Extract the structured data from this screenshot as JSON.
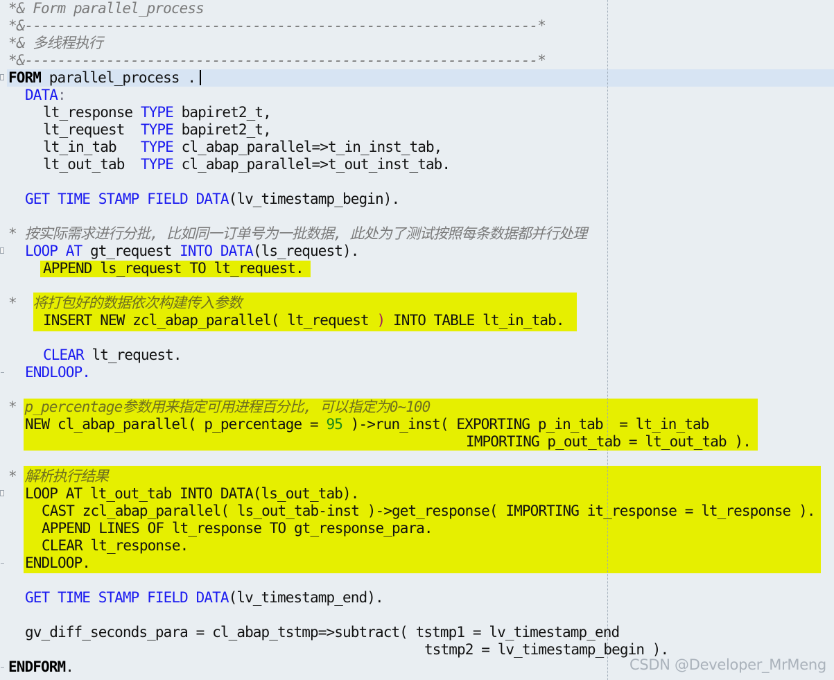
{
  "watermark": "CSDN @Developer_MrMeng",
  "code": {
    "l01": "*& Form parallel_process",
    "l02": "*&---------------------------------------------------------------*",
    "l03": "*& 多线程执行",
    "l04": "*&---------------------------------------------------------------*",
    "l05_kw": "FORM",
    "l05_rest": " parallel_process .",
    "l06_kw": "DATA",
    "l06_rest": ":",
    "l07_a": "lt_response ",
    "l07_kw": "TYPE",
    "l07_b": " bapiret2_t,",
    "l08_a": "lt_request  ",
    "l08_kw": "TYPE",
    "l08_b": " bapiret2_t,",
    "l09_a": "lt_in_tab   ",
    "l09_kw": "TYPE",
    "l09_b": " cl_abap_parallel=>t_in_inst_tab,",
    "l10_a": "lt_out_tab  ",
    "l10_kw": "TYPE",
    "l10_b": " cl_abap_parallel=>t_out_inst_tab.",
    "l12_kw": "GET TIME STAMP FIELD DATA",
    "l12_rest": "(lv_timestamp_begin).",
    "l14": "* 按实际需求进行分批, 比如同一订单号为一批数据, 此处为了测试按照每条数据都并行处理",
    "l15_kw1": "LOOP AT",
    "l15_a": " gt_request ",
    "l15_kw2": "INTO DATA",
    "l15_b": "(ls_request).",
    "l16": "APPEND ls_request TO lt_request.",
    "l18_star": "*  ",
    "l18_text": "将打包好的数据依次构建传入参数",
    "l19_a": "INSERT NEW zcl_abap_parallel( lt_request ",
    "l19_paren": ")",
    "l19_b": " INTO TABLE lt_in_tab.",
    "l21_kw": "CLEAR",
    "l21_rest": " lt_request.",
    "l22": "ENDLOOP.",
    "l24_star": "* ",
    "l24_text": "p_percentage参数用来指定可用进程百分比, 可以指定为0~100",
    "l25_a": "NEW cl_abap_parallel( p_percentage = ",
    "l25_num": "95",
    "l25_b": " )->run_inst( EXPORTING p_in_tab  = lt_in_tab",
    "l26": "IMPORTING p_out_tab = lt_out_tab ).",
    "l28_star": "* ",
    "l28_text": "解析执行结果",
    "l29": "LOOP AT lt_out_tab INTO DATA(ls_out_tab).",
    "l30": "CAST zcl_abap_parallel( ls_out_tab-inst )->get_response( IMPORTING it_response = lt_response ).",
    "l31": "APPEND LINES OF lt_response TO gt_response_para.",
    "l32": "CLEAR lt_response.",
    "l33": "ENDLOOP.",
    "l35_kw": "GET TIME STAMP FIELD DATA",
    "l35_rest": "(lv_timestamp_end).",
    "l37": "gv_diff_seconds_para = cl_abap_tstmp=>subtract( tstmp1 = lv_timestamp_end",
    "l38": "tstmp2 = lv_timestamp_begin ).",
    "l39_kw": "ENDFORM",
    "l39_rest": "."
  }
}
